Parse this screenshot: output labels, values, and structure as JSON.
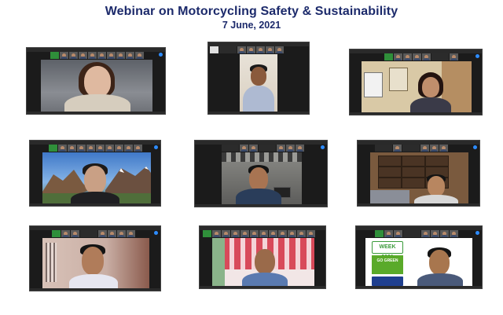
{
  "header": {
    "title": "Webinar on Motorcycling Safety & Sustainability",
    "date": "7 June, 2021"
  },
  "eco_card": {
    "week_text": "WEEK 2021",
    "go_text": "GO GREEN"
  },
  "colors": {
    "title": "#1c2a6b",
    "zoom_blue": "#2d8cff",
    "window_bg": "#1b1b1b",
    "eco_green": "#5aaa2a"
  }
}
